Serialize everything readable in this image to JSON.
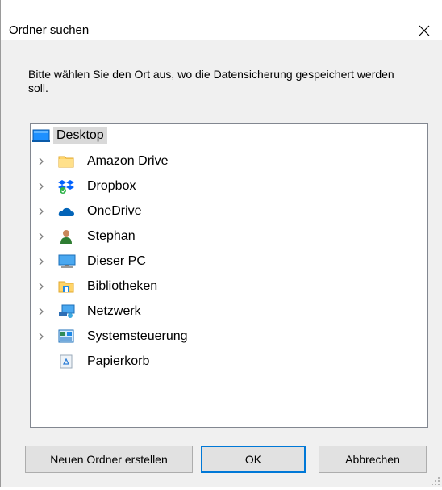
{
  "dialog": {
    "title": "Ordner suchen",
    "instruction": "Bitte wählen Sie den Ort aus, wo die Datensicherung gespeichert werden soll."
  },
  "tree": {
    "root": {
      "label": "Desktop",
      "icon": "desktop-icon",
      "selected": true
    },
    "items": [
      {
        "label": "Amazon Drive",
        "icon": "folder-icon",
        "expandable": true
      },
      {
        "label": "Dropbox",
        "icon": "dropbox-icon",
        "expandable": true
      },
      {
        "label": "OneDrive",
        "icon": "onedrive-icon",
        "expandable": true
      },
      {
        "label": "Stephan",
        "icon": "user-icon",
        "expandable": true
      },
      {
        "label": "Dieser PC",
        "icon": "computer-icon",
        "expandable": true
      },
      {
        "label": "Bibliotheken",
        "icon": "libraries-icon",
        "expandable": true
      },
      {
        "label": "Netzwerk",
        "icon": "network-icon",
        "expandable": true
      },
      {
        "label": "Systemsteuerung",
        "icon": "control-panel-icon",
        "expandable": true
      },
      {
        "label": "Papierkorb",
        "icon": "recycle-bin-icon",
        "expandable": false
      }
    ]
  },
  "buttons": {
    "new_folder": "Neuen Ordner erstellen",
    "ok": "OK",
    "cancel": "Abbrechen"
  },
  "colors": {
    "accent": "#0078d7",
    "selection": "#d9d9d9",
    "dialog_bg": "#f0f0f0"
  }
}
